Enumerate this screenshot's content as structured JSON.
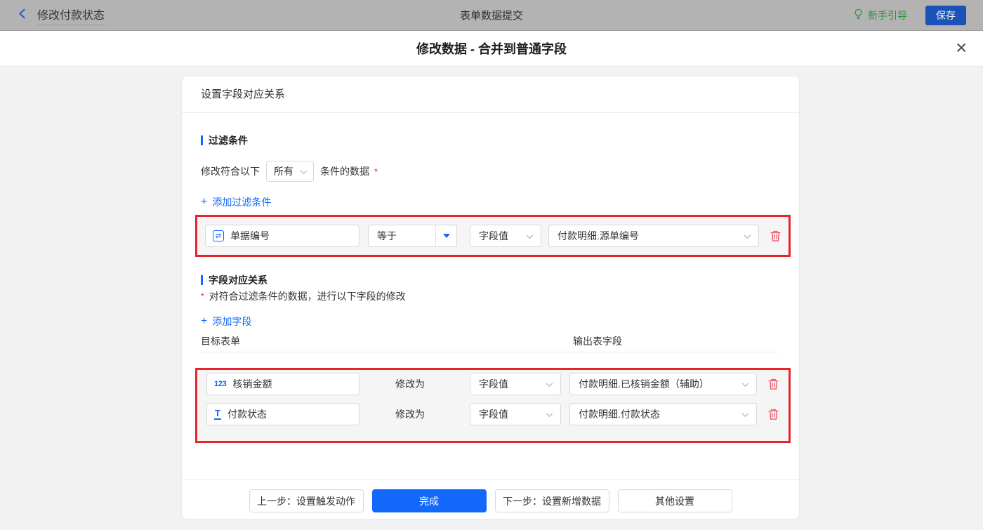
{
  "topbar": {
    "back_title": "修改付款状态",
    "center_title": "表单数据提交",
    "guide_label": "新手引导",
    "save_label": "保存"
  },
  "modal": {
    "title": "修改数据 - 合并到普通字段",
    "close_glyph": "✕"
  },
  "panel": {
    "header_title": "设置字段对应关系"
  },
  "filter_section": {
    "title": "过滤条件",
    "match_prefix": "修改符合以下",
    "match_value": "所有",
    "match_suffix": "条件的数据",
    "required_mark": "*",
    "plus_glyph": "+",
    "add_label": "添加过滤条件",
    "row": {
      "field_icon_glyph": "⇄",
      "field_label": "单据编号",
      "operator": "等于",
      "value_type": "字段值",
      "value": "付款明细.源单编号"
    }
  },
  "mapping_section": {
    "title": "字段对应关系",
    "required_mark": "*",
    "description": "对符合过滤条件的数据，进行以下字段的修改",
    "plus_glyph": "+",
    "add_label": "添加字段",
    "columns": {
      "left": "目标表单",
      "right": "输出表字段"
    },
    "rows": [
      {
        "field_icon_glyph": "123",
        "field_label": "核销金额",
        "action_label": "修改为",
        "value_type": "字段值",
        "value": "付款明细.已核销金额（辅助）"
      },
      {
        "field_icon_glyph": "T",
        "field_label": "付款状态",
        "action_label": "修改为",
        "value_type": "字段值",
        "value": "付款明细.付款状态"
      }
    ]
  },
  "footer": {
    "prev_label": "上一步：设置触发动作",
    "done_label": "完成",
    "next_label": "下一步：设置新增数据",
    "other_label": "其他设置"
  },
  "colors": {
    "primary_blue": "#1268fb",
    "annotation_red": "#e7242b",
    "danger_pink": "#f05a66",
    "guide_green": "#2e9140",
    "topbar_gray": "#b3b3b3"
  }
}
